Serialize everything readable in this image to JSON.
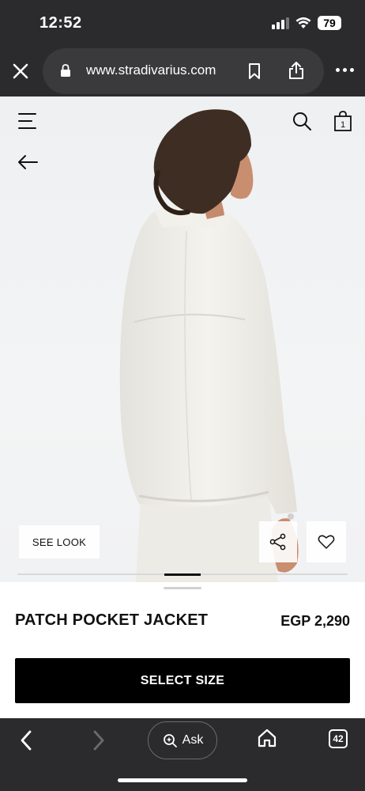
{
  "status_bar": {
    "time": "12:52",
    "battery": "79",
    "icons": [
      "signal-icon",
      "wifi-icon",
      "battery-icon"
    ]
  },
  "browser": {
    "url": "www.stradivarius.com",
    "icons": [
      "close-icon",
      "lock-icon",
      "bookmark-icon",
      "share-icon",
      "more-icon"
    ]
  },
  "header": {
    "icons": [
      "menu-icon",
      "search-icon",
      "bag-icon",
      "back-arrow-icon"
    ],
    "bag_count": "1"
  },
  "hero": {
    "see_look_label": "SEE LOOK",
    "image_description": "model wearing white jacket",
    "icons": [
      "share-icon",
      "heart-icon"
    ],
    "slides_total": 1,
    "slide_active": 1
  },
  "product": {
    "name": "PATCH POCKET JACKET",
    "price": "EGP 2,290",
    "select_size_label": "SELECT SIZE"
  },
  "bottom_nav": {
    "ask_label": "Ask",
    "tab_count": "42",
    "icons": [
      "back-icon",
      "forward-icon",
      "ask-sparkle-icon",
      "home-icon",
      "tabs-icon"
    ]
  }
}
